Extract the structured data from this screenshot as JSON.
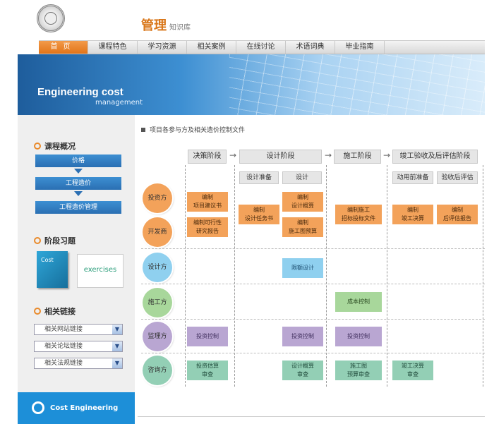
{
  "header": {
    "brand_main": "管理",
    "brand_sub": "知识库"
  },
  "nav": {
    "items": [
      "首页",
      "课程特色",
      "学习资源",
      "相关案例",
      "在线讨论",
      "术语词典",
      "毕业指南"
    ]
  },
  "banner": {
    "title": "Engineering cost",
    "subtitle": "management"
  },
  "sidebar": {
    "overview_title": "课程概况",
    "flow": [
      "价格",
      "工程造价",
      "工程造价管理"
    ],
    "practice_title": "阶段习题",
    "book_label": "Cost",
    "exercises_label": "exercises",
    "links_title": "相关链接",
    "links": [
      "相关网站链接",
      "相关论坛链接",
      "相关法规链接"
    ],
    "cost_button": "Cost Engineering"
  },
  "main": {
    "section_title": "项目各参与方及相关造价控制文件",
    "stages": [
      "决策阶段",
      "设计阶段",
      "施工阶段",
      "竣工验收及后评估阶段"
    ],
    "sub_stages": [
      "设计准备",
      "设计",
      "动用前准备",
      "验收后评估"
    ],
    "roles": [
      "投资方",
      "开发商",
      "设计方",
      "施工方",
      "监理方",
      "咨询方"
    ],
    "tasks": {
      "inv_decision_1": "编制\n项目建议书",
      "inv_decision_2": "编制可行性\n研究报告",
      "inv_design_prep": "编制\n设计任务书",
      "inv_design_1": "编制\n设计概算",
      "inv_design_2": "编制\n施工图预算",
      "inv_construction": "编制施工\n招标投标文件",
      "inv_acceptance_1": "编制\n竣工决算",
      "inv_acceptance_2": "编制\n后评估报告",
      "designer": "限额设计",
      "builder": "成本控制",
      "sup_decision": "投资控制",
      "sup_design": "投资控制",
      "sup_construction": "投资控制",
      "con_decision": "投资估算\n审查",
      "con_design": "设计概算\n审查",
      "con_construction": "施工图\n预算审查",
      "con_acceptance": "竣工决算\n审查"
    }
  },
  "colors": {
    "accent_orange": "#e27418",
    "banner_blue": "#1e5d9c",
    "role_orange": "#f3a25a",
    "role_blue": "#8fd0ef",
    "role_green": "#a8d79b",
    "role_purple": "#b9a6d2",
    "role_teal": "#93cfb5"
  }
}
